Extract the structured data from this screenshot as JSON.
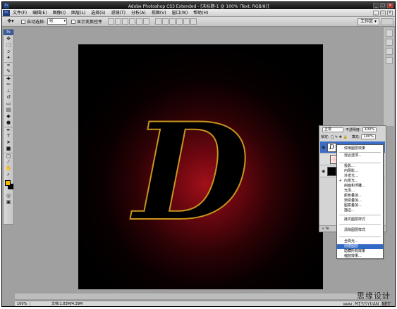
{
  "window": {
    "title": "Adobe Photoshop CS3 Extended - [未标题-1 @ 100% (Text, RGB/8)]",
    "logo": "Ps",
    "controls": [
      "_",
      "□",
      "✕"
    ]
  },
  "menubar": {
    "logo": "Ps",
    "items": [
      "文件(F)",
      "编辑(E)",
      "图像(I)",
      "图层(L)",
      "选择(S)",
      "滤镜(T)",
      "分析(A)",
      "视图(V)",
      "窗口(W)",
      "帮助(H)"
    ]
  },
  "options": {
    "auto_select_label": "自动选择:",
    "auto_select_value": "组",
    "show_transform_label": "显示变换控件",
    "workspace_label": "工作区 ▾"
  },
  "toolbox": {
    "header": "Ps",
    "fg_color": "#f5b800",
    "bg_color": "#000000"
  },
  "canvas": {
    "letter": "D",
    "letter_fill": "#000000",
    "stroke_color": "#c8951c"
  },
  "layers_panel": {
    "blend_mode": "正常",
    "opacity_label": "不透明度:",
    "opacity_value": "100%",
    "lock_label": "锁定:",
    "fill_label": "填充:",
    "fill_value": "100%",
    "bottom_icons": "∞  fx"
  },
  "context_menu": {
    "items": [
      {
        "label": "停用图层效果",
        "checked": false,
        "hl": false
      },
      {
        "label": "混合选项...",
        "checked": false,
        "hl": false
      },
      {
        "label": "投影...",
        "checked": false,
        "hl": false
      },
      {
        "label": "内阴影...",
        "checked": false,
        "hl": false
      },
      {
        "label": "外发光...",
        "checked": false,
        "hl": false
      },
      {
        "label": "内发光...",
        "checked": true,
        "hl": false
      },
      {
        "label": "斜面和浮雕...",
        "checked": false,
        "hl": false
      },
      {
        "label": "光泽...",
        "checked": false,
        "hl": false
      },
      {
        "label": "颜色叠加...",
        "checked": false,
        "hl": false
      },
      {
        "label": "渐变叠加...",
        "checked": false,
        "hl": false
      },
      {
        "label": "图案叠加...",
        "checked": false,
        "hl": false
      },
      {
        "label": "描边...",
        "checked": false,
        "hl": false
      },
      {
        "label": "拷贝图层样式",
        "checked": false,
        "hl": false
      },
      {
        "label": "清除图层样式",
        "checked": false,
        "hl": false
      },
      {
        "label": "全局光...",
        "checked": false,
        "hl": false
      },
      {
        "label": "创建图层",
        "checked": false,
        "hl": true
      },
      {
        "label": "隐藏所有效果",
        "checked": false,
        "hl": false
      },
      {
        "label": "缩放效果...",
        "checked": false,
        "hl": false
      }
    ]
  },
  "status": {
    "zoom": "100%",
    "doc": "文档:1.83M/4.39M"
  },
  "watermark": {
    "main": "思缘设计",
    "sub": "www.MISSYUAN.NET"
  }
}
